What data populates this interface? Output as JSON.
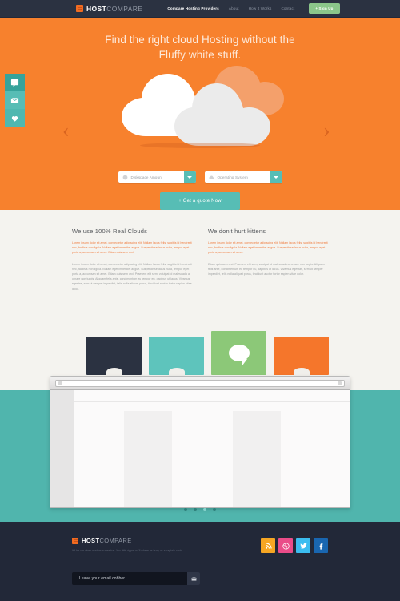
{
  "nav": {
    "logo": {
      "bold": "HOST",
      "light": "COMPARE"
    },
    "links": [
      {
        "label": "Compare Hosting  Providers",
        "active": true
      },
      {
        "label": "About",
        "active": false
      },
      {
        "label": "How it Works",
        "active": false
      },
      {
        "label": "Contact",
        "active": false
      }
    ],
    "signup_label": "+ Sign Up"
  },
  "hero": {
    "title_line1": "Find the right cloud Hosting without the",
    "title_line2": "Fluffy white stuff.",
    "rail": [
      {
        "icon": "chat-icon"
      },
      {
        "icon": "envelope-icon"
      },
      {
        "icon": "heart-icon"
      }
    ],
    "arrow_left": "‹",
    "arrow_right": "›",
    "selects": [
      {
        "label": "Diskspace Amount",
        "icon": "disk-icon"
      },
      {
        "label": "Operating System",
        "icon": "cloud-icon"
      }
    ],
    "quote_label": "+ Get a quote Now"
  },
  "content": {
    "columns": [
      {
        "heading": "We use 100% Real Clouds",
        "lead": "Lorem ipsum dolor sit amet, consectetur adipiscing elit. Nullam lacus felis, sagittis id hendrerit nec, facilisis non ligula. Nullam eget imperdiet augue. Suspendisse lacus nulla, tempor eget porta a, accumsan sit amet. Etiam quis sem orci.",
        "body": "Lorem ipsum dolor sit amet, consectetur adipiscing elit. Nullam lacus felis, sagittis id hendrerit nec, facilisis non ligula. Nullam eget imperdiet augue. Suspendisse lacus nulla, tempor eget porta a, accumsan sit amet. Etiam quis sem orci. Praesent elit sem, volutpat id malesuada a, ornare non turpis. Aliquam felis ante, condimentum eu tempor eu, dapibus ut lacus. Vivamus egestas, sem ut semper imperdiet, felis nulla aliquet purus, tincidunt auctor tortor sapien vitae dolor."
      },
      {
        "heading": "We don't hurt kittens",
        "lead": "Lorem ipsum dolor sit amet, consectetur adipiscing elit. Nullam lacus felis, sagittis id hendrerit nec, facilisis non ligula. Nullam eget imperdiet augue. Suspendisse lacus nulla, tempor eget porta a, accumsan sit amet.",
        "body": "Etiam quis sem orci. Praesent elit sem, volutpat id malesuada a, ornare non turpis. Aliquam felis ante, condimentum eu tempor eu, dapibus ut lacus. Vivamus egestas, sem ut semper imperdiet, felis nulla aliquet purus, tincidunt auctor tortor sapien vitae dolor."
      }
    ]
  },
  "showcase": {
    "cards": [
      {
        "name": "card-dark",
        "color": "#2b3241"
      },
      {
        "name": "card-teal",
        "color": "#5ec4bc"
      },
      {
        "name": "card-green",
        "color": "#8cc878"
      },
      {
        "name": "card-orange",
        "color": "#f5762b"
      }
    ],
    "dots": [
      {
        "active": false
      },
      {
        "active": false
      },
      {
        "active": true
      },
      {
        "active": false
      }
    ]
  },
  "footer": {
    "logo": {
      "bold": "HOST",
      "light": "COMPARE"
    },
    "tagline": "It'll be ute when mad as a meerkat. You little ripper no'll where as busy as a captain cook.",
    "socials": [
      {
        "name": "rss",
        "label": "RSS"
      },
      {
        "name": "dribbble",
        "label": "Dribbble"
      },
      {
        "name": "twitter",
        "label": "Twitter"
      },
      {
        "name": "facebook",
        "label": "Facebook"
      }
    ],
    "email_placeholder": "Leave your email cobber",
    "email_value": ""
  },
  "colors": {
    "brand_orange": "#f7812d",
    "teal": "#57bdb5",
    "dark": "#2b3241",
    "footer_dark": "#222838",
    "green": "#8bc68a"
  }
}
